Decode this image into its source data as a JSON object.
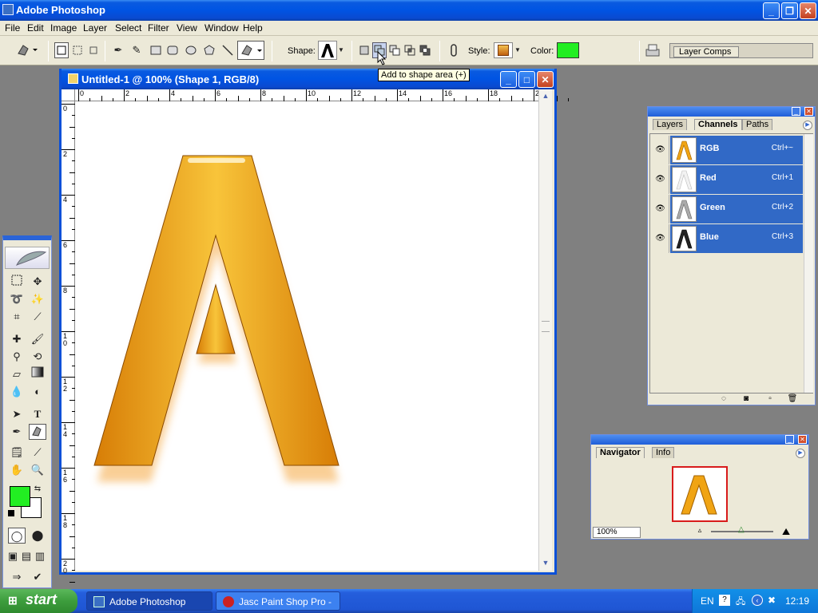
{
  "app": {
    "title": "Adobe Photoshop"
  },
  "menu": [
    "File",
    "Edit",
    "Image",
    "Layer",
    "Select",
    "Filter",
    "View",
    "Window",
    "Help"
  ],
  "options_bar": {
    "shape_label": "Shape:",
    "style_label": "Style:",
    "color_label": "Color:",
    "color_value": "#22ee22",
    "layer_comps_tab": "Layer Comps",
    "tooltip": "Add to shape area (+)"
  },
  "document": {
    "title": "Untitled-1 @ 100% (Shape 1, RGB/8)",
    "h_ruler": [
      "0",
      "2",
      "4",
      "6",
      "8",
      "10",
      "12",
      "14",
      "16",
      "18",
      "20"
    ],
    "v_ruler": [
      "0",
      "2",
      "4",
      "6",
      "8",
      "1\n0",
      "1\n2",
      "1\n4",
      "1\n6",
      "1\n8",
      "2\n0"
    ],
    "letter": "A",
    "letter_color": "#f0a414"
  },
  "channels_panel": {
    "tabs": [
      "Layers",
      "Channels",
      "Paths"
    ],
    "active_tab": "Channels",
    "channels": [
      {
        "name": "RGB",
        "shortcut": "Ctrl+~"
      },
      {
        "name": "Red",
        "shortcut": "Ctrl+1"
      },
      {
        "name": "Green",
        "shortcut": "Ctrl+2"
      },
      {
        "name": "Blue",
        "shortcut": "Ctrl+3"
      }
    ]
  },
  "navigator_panel": {
    "tabs": [
      "Navigator",
      "Info"
    ],
    "zoom": "100%"
  },
  "toolbox": {
    "foreground_color": "#22ee22",
    "background_color": "#ffffff"
  },
  "taskbar": {
    "start_label": "start",
    "tasks": [
      "Adobe Photoshop",
      "Jasc Paint Shop Pro - ..."
    ],
    "language": "EN",
    "clock": "12:19"
  }
}
